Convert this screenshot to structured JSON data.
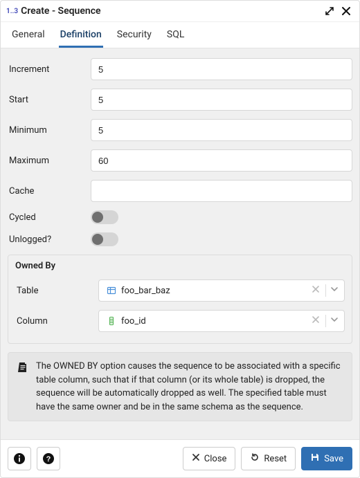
{
  "header": {
    "badge": "1..3",
    "title": "Create - Sequence"
  },
  "tabs": [
    {
      "label": "General",
      "active": false
    },
    {
      "label": "Definition",
      "active": true
    },
    {
      "label": "Security",
      "active": false
    },
    {
      "label": "SQL",
      "active": false
    }
  ],
  "fields": {
    "increment": {
      "label": "Increment",
      "value": "5"
    },
    "start": {
      "label": "Start",
      "value": "5"
    },
    "minimum": {
      "label": "Minimum",
      "value": "5"
    },
    "maximum": {
      "label": "Maximum",
      "value": "60"
    },
    "cache": {
      "label": "Cache",
      "value": ""
    },
    "cycled": {
      "label": "Cycled",
      "value": false
    },
    "unlogged": {
      "label": "Unlogged?",
      "value": false
    }
  },
  "owned_by": {
    "legend": "Owned By",
    "table": {
      "label": "Table",
      "value": "foo_bar_baz"
    },
    "column": {
      "label": "Column",
      "value": "foo_id"
    }
  },
  "note": "The OWNED BY option causes the sequence to be associated with a specific table column, such that if that column (or its whole table) is dropped, the sequence will be automatically dropped as well. The specified table must have the same owner and be in the same schema as the sequence.",
  "footer": {
    "close": "Close",
    "reset": "Reset",
    "save": "Save"
  }
}
